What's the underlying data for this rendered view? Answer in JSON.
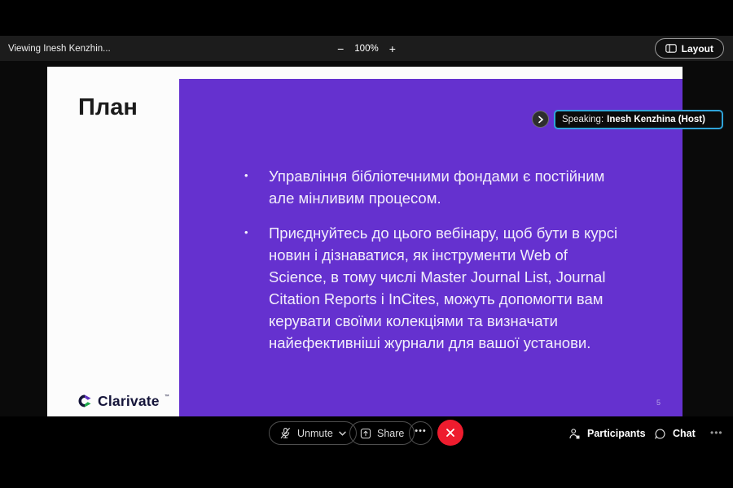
{
  "colors": {
    "slide-purple": "#6531cf",
    "leave-red": "#ee1c2e",
    "speaking-border": "#2fa3d8",
    "clarivate-purple": "#5e33bf",
    "clarivate-green": "#1fa84b",
    "clarivate-navy": "#15153a"
  },
  "top_bar": {
    "viewing_label": "Viewing Inesh Kenzhin...",
    "zoom_out_glyph": "−",
    "zoom_level": "100%",
    "zoom_in_glyph": "+",
    "layout_label": "Layout"
  },
  "speaking_indicator": {
    "chevron_glyph": "›",
    "prefix": "Speaking:",
    "name": "Inesh Kenzhina (Host)"
  },
  "slide": {
    "title": "План",
    "bullet_marker": "•",
    "bullets": [
      {
        "text": "Управління бібліотечними фондами є постійним але мінливим процесом."
      },
      {
        "text": "Приєднуйтесь до цього вебінару, щоб бути в курсі новин і дізнаватися, як інструменти Web of Science,  в тому числі Master Journal List, Journal Citation Reports і InCites, можуть допомогти вам керувати своїми колекціями та визначати найефективніші журнали для вашої установи."
      }
    ],
    "logo_text": "Clarivate",
    "logo_tm": "™",
    "page_number": "5"
  },
  "toolbar": {
    "unmute_label": "Unmute",
    "share_label": "Share",
    "more_glyph": "•••",
    "participants_label": "Participants",
    "chat_label": "Chat",
    "overflow_glyph": "•••"
  }
}
